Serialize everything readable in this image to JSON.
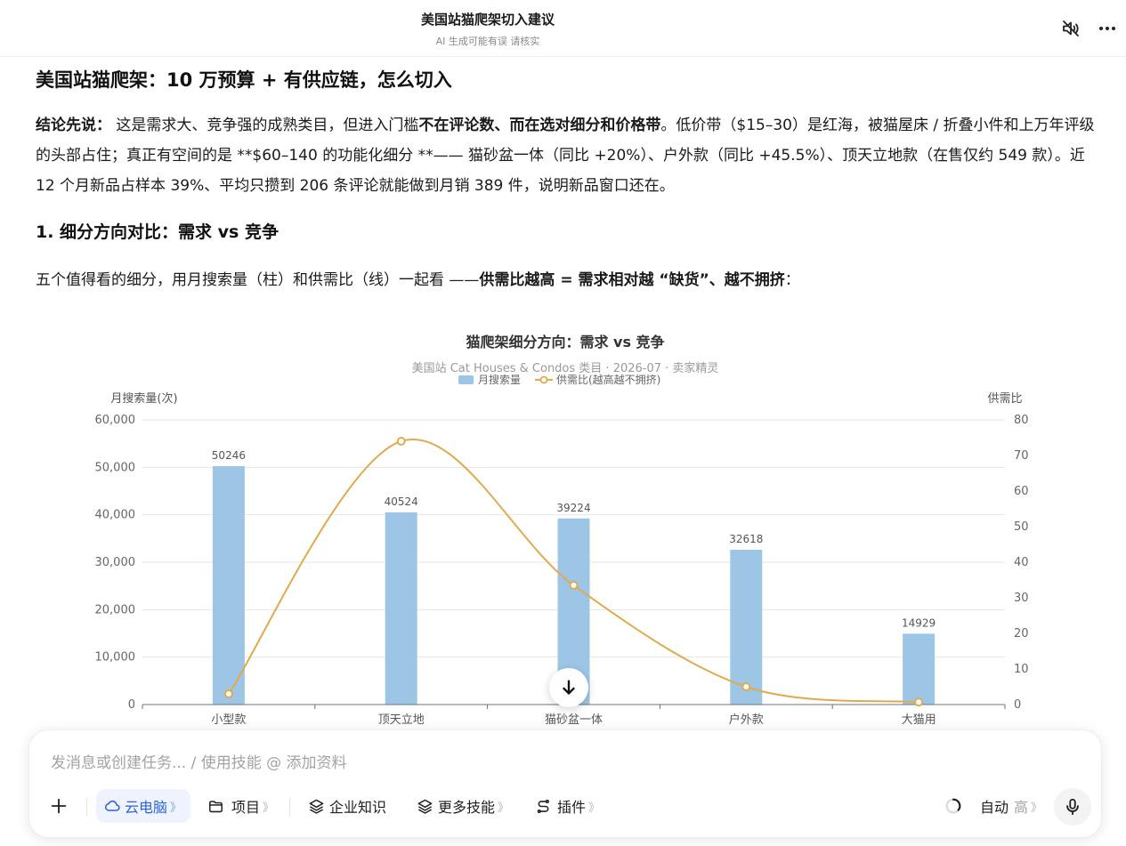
{
  "header": {
    "title": "美国站猫爬架切入建议",
    "subtitle": "AI 生成可能有误 请核实"
  },
  "article": {
    "h1": "美国站猫爬架：10 万预算 + 有供应链，怎么切入",
    "p1": {
      "lead": "结论先说：",
      "t1": " 这是需求大、竞争强的成熟类目，但进入门槛",
      "b1": "不在评论数、而在选对细分和价格带",
      "t2": "。低价带（$15–30）是红海，被猫屋床 / 折叠小件和上万年评级的头部占住；真正有空间的是 **$60–140 的功能化细分 **—— 猫砂盆一体（同比 +20%）、户外款（同比 +45.5%）、顶天立地款（在售仅约 549 款）。近 12 个月新品占样本 39%、平均只攒到 206 条评论就能做到月销 389 件，说明新品窗口还在。"
    },
    "h2": "1. 细分方向对比：需求 vs 竞争",
    "p2": {
      "t1": "五个值得看的细分，用月搜索量（柱）和供需比（线）一起看 ——",
      "b1": "供需比越高 = 需求相对越 “缺货”、越不拥挤",
      "t2": "："
    }
  },
  "chart_data": {
    "type": "bar",
    "title": "猫爬架细分方向：需求 vs 竞争",
    "subtitle": "美国站 Cat Houses & Condos 类目 · 2026-07 · 卖家精灵",
    "categories": [
      "小型款",
      "顶天立地",
      "猫砂盆一体",
      "户外款",
      "大猫用"
    ],
    "series": [
      {
        "name": "月搜索量",
        "type": "bar",
        "axis": "left",
        "color": "#9dc6e6",
        "values": [
          50246,
          40524,
          39224,
          32618,
          14929
        ]
      },
      {
        "name": "供需比(越高越不拥挤)",
        "type": "line",
        "axis": "right",
        "color": "#e0aa4f",
        "values": [
          3,
          74,
          33.5,
          5,
          0.7
        ]
      }
    ],
    "ylabel": "月搜索量(次)",
    "y2label": "供需比",
    "ylim": [
      0,
      60000
    ],
    "y2lim": [
      0,
      80
    ],
    "yticks": [
      "0",
      "10,000",
      "20,000",
      "30,000",
      "40,000",
      "50,000",
      "60,000"
    ],
    "y2ticks": [
      "0",
      "10",
      "20",
      "30",
      "40",
      "50",
      "60",
      "70",
      "80"
    ],
    "grid": true,
    "legend": "top-center"
  },
  "composer": {
    "placeholder": "发消息或创建任务... / 使用技能 @ 添加资料",
    "tools": {
      "cloud": "云电脑",
      "project": "项目",
      "knowledge": "企业知识",
      "skills": "更多技能",
      "plugins": "插件"
    },
    "mode": "自动",
    "level": "高",
    "chevron": "》"
  },
  "icons": {
    "mute": "speaker-muted-icon",
    "more": "more-horizontal-icon",
    "scroll": "arrow-down-icon",
    "plus": "plus-icon",
    "cloud": "cloud-icon",
    "folder": "folder-icon",
    "layers": "layers-icon",
    "plugin": "plugin-icon",
    "loading": "loading-ring-icon",
    "mic": "microphone-icon"
  },
  "colors": {
    "bar": "#9dc6e6",
    "line": "#e0aa4f",
    "accent": "#2c63d8"
  }
}
